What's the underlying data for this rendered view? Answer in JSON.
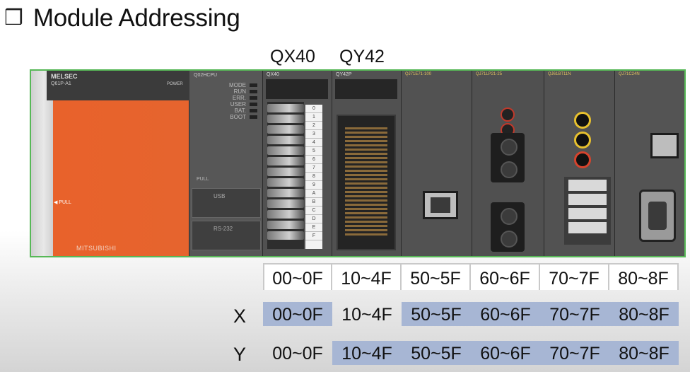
{
  "title": {
    "icon": "❒",
    "text": "Module Addressing"
  },
  "module_labels": {
    "qx40": "QX40",
    "qy42": "QY42"
  },
  "rack": {
    "psu": {
      "logo": "MELSEC",
      "model": "Q61P-A1",
      "power": "POWER",
      "pull": "◀ PULL",
      "brand": "MITSUBISHI"
    },
    "cpu": {
      "header": "Q02HCPU",
      "leds": [
        "MODE",
        "RUN",
        "ERR.",
        "USER",
        "BAT.",
        "BOOT"
      ],
      "pull": "PULL",
      "usb": "USB",
      "rs232": "RS-232"
    },
    "qx40": {
      "header": "QX40",
      "strip": [
        "0",
        "1",
        "2",
        "3",
        "4",
        "5",
        "6",
        "7",
        "8",
        "9",
        "A",
        "B",
        "C",
        "D",
        "E",
        "F"
      ]
    },
    "qy42": {
      "header": "QY42P"
    },
    "net": {
      "header": "QJ71E71-100"
    },
    "fiber": {
      "header": "QJ71LP21-25"
    },
    "cc": {
      "header": "QJ61BT11N"
    },
    "ser": {
      "header": "QJ71C24N"
    }
  },
  "address_rows": {
    "slots": [
      "00~0F",
      "10~4F",
      "50~5F",
      "60~6F",
      "70~7F",
      "80~8F"
    ],
    "x": {
      "label": "X",
      "values": [
        "00~0F",
        "10~4F",
        "50~5F",
        "60~6F",
        "70~7F",
        "80~8F"
      ],
      "highlighted": [
        true,
        false,
        true,
        true,
        true,
        true
      ]
    },
    "y": {
      "label": "Y",
      "values": [
        "00~0F",
        "10~4F",
        "50~5F",
        "60~6F",
        "70~7F",
        "80~8F"
      ],
      "highlighted": [
        false,
        true,
        true,
        true,
        true,
        true
      ]
    }
  },
  "colors": {
    "highlight": "#a7b6d4",
    "rack_outline": "#57b857",
    "psu": "#e6642e"
  }
}
